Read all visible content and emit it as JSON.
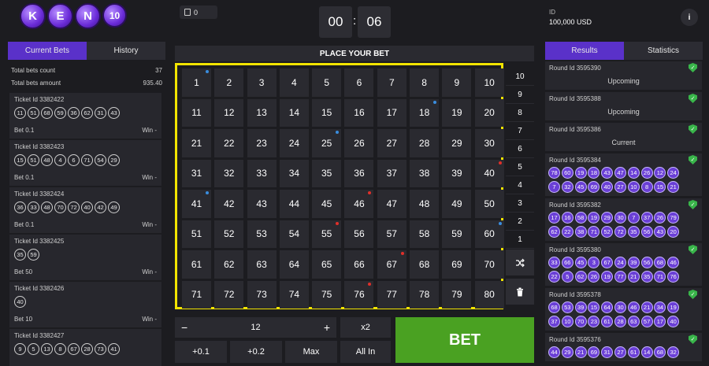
{
  "logo": {
    "letters": [
      "K",
      "E",
      "N",
      "10"
    ]
  },
  "left": {
    "tabs": [
      "Current Bets",
      "History"
    ],
    "total_bets_count_label": "Total bets count",
    "total_bets_count": "37",
    "total_bets_amount_label": "Total bets amount",
    "total_bets_amount": "935.40",
    "tickets": [
      {
        "id": "Ticket Id 3382422",
        "nums": [
          "11",
          "51",
          "68",
          "59",
          "36",
          "62",
          "31",
          "43"
        ],
        "bet": "Bet 0.1",
        "win": "Win -"
      },
      {
        "id": "Ticket Id 3382423",
        "nums": [
          "15",
          "51",
          "48",
          "4",
          "6",
          "71",
          "54",
          "29"
        ],
        "bet": "Bet 0.1",
        "win": "Win -"
      },
      {
        "id": "Ticket Id 3382424",
        "nums": [
          "36",
          "33",
          "48",
          "70",
          "72",
          "40",
          "42",
          "49"
        ],
        "bet": "Bet 0.1",
        "win": "Win -"
      },
      {
        "id": "Ticket Id 3382425",
        "nums": [
          "35",
          "59"
        ],
        "bet": "Bet 50",
        "win": "Win -"
      },
      {
        "id": "Ticket Id 3382426",
        "nums": [
          "40"
        ],
        "bet": "Bet 10",
        "win": "Win -"
      },
      {
        "id": "Ticket Id 3382427",
        "nums": [
          "9",
          "5",
          "13",
          "8",
          "67",
          "28",
          "73",
          "41"
        ],
        "bet": "",
        "win": ""
      }
    ]
  },
  "center": {
    "bet_count": "0",
    "timer_min": "00",
    "timer_sec": "06",
    "colon": ":",
    "place_bet": "PLACE YOUR BET",
    "numbers": [
      "1",
      "2",
      "3",
      "4",
      "5",
      "6",
      "7",
      "8",
      "9",
      "10",
      "11",
      "12",
      "13",
      "14",
      "15",
      "16",
      "17",
      "18",
      "19",
      "20",
      "21",
      "22",
      "23",
      "24",
      "25",
      "26",
      "27",
      "28",
      "29",
      "30",
      "31",
      "32",
      "33",
      "34",
      "35",
      "36",
      "37",
      "38",
      "39",
      "40",
      "41",
      "42",
      "43",
      "44",
      "45",
      "46",
      "47",
      "48",
      "49",
      "50",
      "51",
      "52",
      "53",
      "54",
      "55",
      "56",
      "57",
      "58",
      "59",
      "60",
      "61",
      "62",
      "63",
      "64",
      "65",
      "66",
      "67",
      "68",
      "69",
      "70",
      "71",
      "72",
      "73",
      "74",
      "75",
      "76",
      "77",
      "78",
      "79",
      "80"
    ],
    "dots": {
      "1": "#3a8dde",
      "18": "#3a8dde",
      "25": "#3a8dde",
      "40": "#e0302a",
      "41": "#3a8dde",
      "46": "#e0302a",
      "55": "#e0302a",
      "60": "#3a8dde",
      "67": "#e0302a",
      "76": "#e0302a"
    },
    "hits": [
      "10",
      "9",
      "8",
      "7",
      "6",
      "5",
      "4",
      "3",
      "2",
      "1"
    ],
    "random_icon": "shuffle-icon",
    "clear_icon": "trash-icon",
    "minus": "−",
    "amount": "12",
    "plus": "+",
    "x2": "x2",
    "add01": "+0.1",
    "add02": "+0.2",
    "max": "Max",
    "allin": "All In",
    "bet": "BET"
  },
  "right": {
    "id_label": "ID",
    "balance": "100,000 USD",
    "info": "i",
    "tabs": [
      "Results",
      "Statistics"
    ],
    "rounds": [
      {
        "id": "Round Id 3595390",
        "status": "Upcoming"
      },
      {
        "id": "Round Id 3595388",
        "status": "Upcoming"
      },
      {
        "id": "Round Id 3595386",
        "status": "Current"
      },
      {
        "id": "Round Id 3595384",
        "nums": [
          "78",
          "60",
          "19",
          "18",
          "43",
          "47",
          "14",
          "26",
          "12",
          "24",
          "7",
          "32",
          "45",
          "69",
          "40",
          "27",
          "10",
          "8",
          "15",
          "21"
        ]
      },
      {
        "id": "Round Id 3595382",
        "nums": [
          "17",
          "16",
          "58",
          "19",
          "29",
          "30",
          "7",
          "37",
          "26",
          "79",
          "62",
          "22",
          "38",
          "71",
          "52",
          "72",
          "35",
          "56",
          "43",
          "20"
        ]
      },
      {
        "id": "Round Id 3595380",
        "nums": [
          "33",
          "66",
          "45",
          "3",
          "67",
          "24",
          "39",
          "56",
          "68",
          "46",
          "22",
          "5",
          "62",
          "26",
          "19",
          "77",
          "21",
          "35",
          "71",
          "76"
        ]
      },
      {
        "id": "Round Id 3595378",
        "nums": [
          "68",
          "53",
          "39",
          "15",
          "64",
          "30",
          "46",
          "21",
          "34",
          "19",
          "37",
          "10",
          "70",
          "23",
          "61",
          "28",
          "63",
          "57",
          "17",
          "40"
        ]
      },
      {
        "id": "Round Id 3595376",
        "nums": [
          "44",
          "29",
          "21",
          "69",
          "31",
          "27",
          "61",
          "14",
          "68",
          "32"
        ]
      }
    ]
  },
  "colors": {
    "accent": "#5a31c9",
    "bet_green": "#4aa122",
    "highlight": "#f2e400",
    "check": "#39b54a"
  }
}
